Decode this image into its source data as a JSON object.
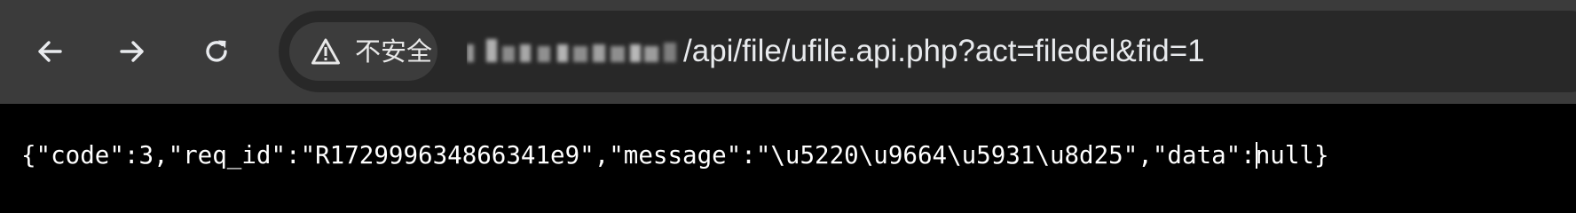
{
  "browser": {
    "nav": {
      "back_icon": "arrow-left-icon",
      "forward_icon": "arrow-right-icon",
      "reload_icon": "reload-icon"
    },
    "address_bar": {
      "security_icon": "warning-triangle-icon",
      "security_label": "不安全",
      "url_path": "/api/file/ufile.api.php?act=filedel&fid=1"
    },
    "colors": {
      "toolbar_bg": "#3b3b3b",
      "omnibox_bg": "#282828",
      "chip_bg": "#3c3c3c",
      "page_bg": "#000000",
      "text": "#ffffff"
    }
  },
  "page": {
    "response_before_cursor": "{\"code\":3,\"req_id\":\"R172999634866341e9\",\"message\":\"\\u5220\\u9664\\u5931\\u8d25\",\"data\":",
    "response_after_cursor": "null}"
  }
}
